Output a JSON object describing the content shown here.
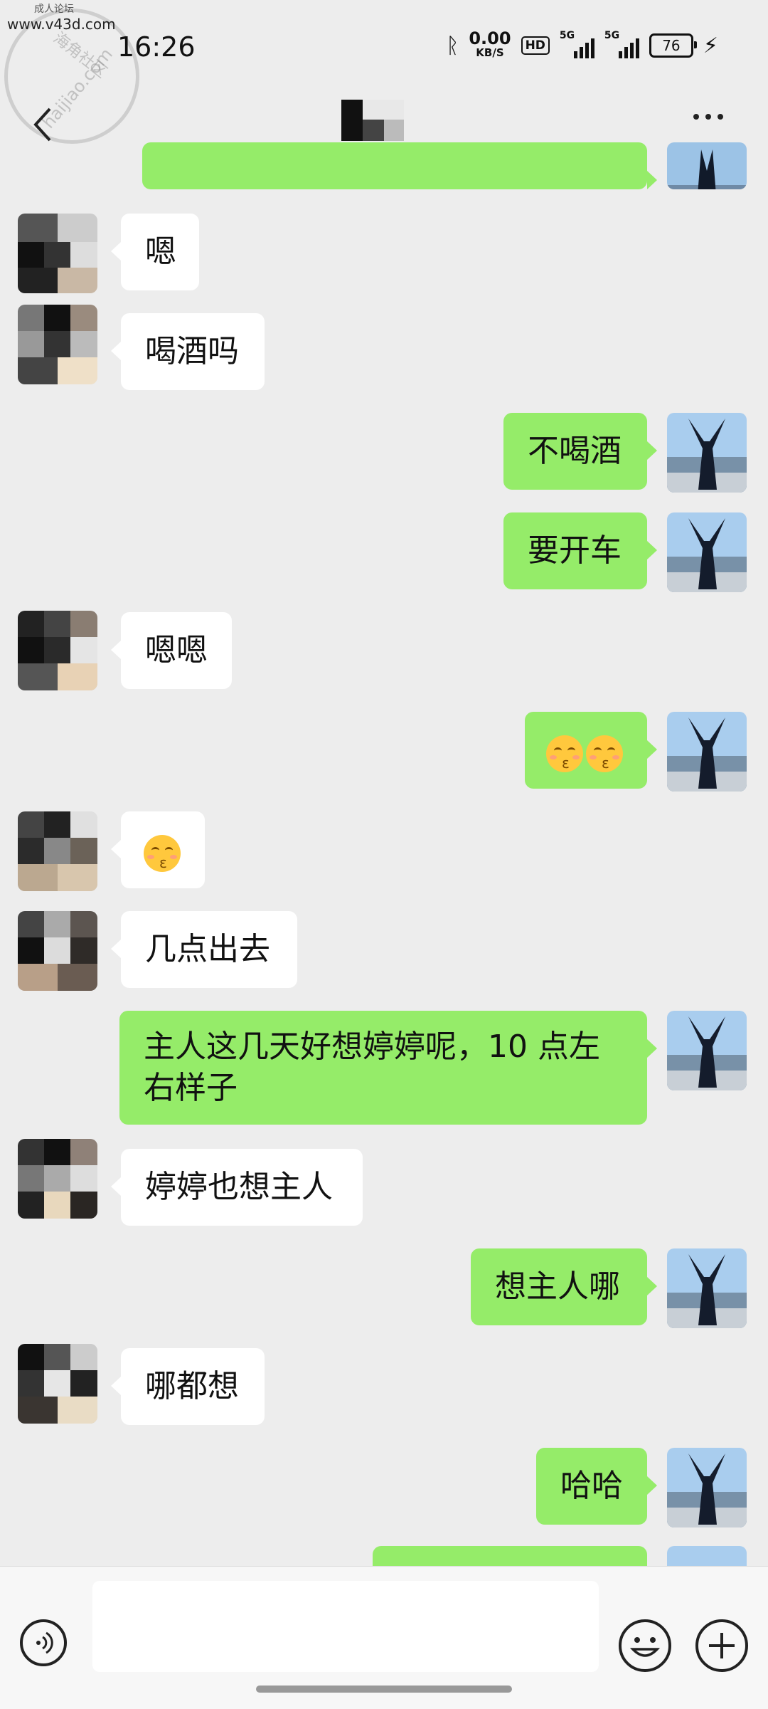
{
  "watermark": {
    "line1": "成人论坛",
    "line2": "www.v43d.com",
    "line3": "海角社区",
    "line4": "haijiao.com"
  },
  "status_bar": {
    "time": "16:26",
    "net_speed_value": "0.00",
    "net_speed_unit": "KB/S",
    "hd_label": "HD",
    "signal1_label": "5G",
    "signal2_label": "5G",
    "battery": "76"
  },
  "nav": {
    "back_icon": "chevron-left-icon",
    "more_icon": "more-icon"
  },
  "messages": [
    {
      "side": "right",
      "text": ""
    },
    {
      "side": "left",
      "text": "嗯"
    },
    {
      "side": "left",
      "text": "喝酒吗"
    },
    {
      "side": "right",
      "text": "不喝酒"
    },
    {
      "side": "right",
      "text": "要开车"
    },
    {
      "side": "left",
      "text": "嗯嗯"
    },
    {
      "side": "right",
      "emoji": "kissing-closed-eyes-emoji",
      "emoji_count": 2
    },
    {
      "side": "left",
      "emoji": "kissing-closed-eyes-emoji",
      "emoji_count": 1
    },
    {
      "side": "left",
      "text": "几点出去"
    },
    {
      "side": "right",
      "text": "主人这几天好想婷婷呢，10 点左右样子"
    },
    {
      "side": "left",
      "text": "婷婷也想主人"
    },
    {
      "side": "right",
      "text": "想主人哪"
    },
    {
      "side": "left",
      "text": "哪都想"
    },
    {
      "side": "right",
      "text": "哈哈"
    },
    {
      "side": "right",
      "text": ""
    }
  ],
  "bottom_bar": {
    "voice_icon": "voice-icon",
    "emoji_icon": "emoji-icon",
    "plus_icon": "plus-icon",
    "input_value": ""
  },
  "colors": {
    "background": "#ededed",
    "my_bubble": "#95ec69",
    "their_bubble": "#ffffff"
  }
}
